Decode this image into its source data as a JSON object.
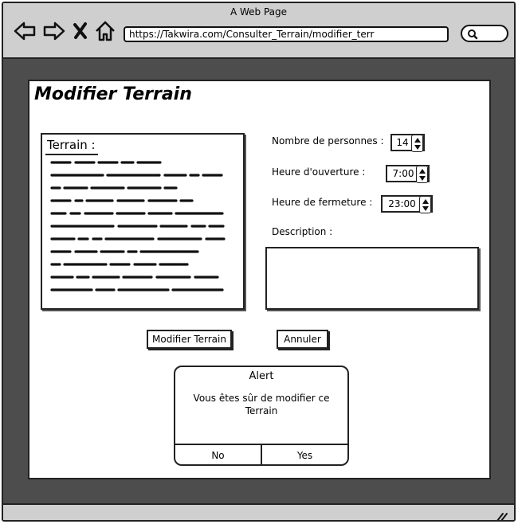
{
  "window": {
    "title": "A Web Page"
  },
  "browser": {
    "url": "https://Takwira.com/Consulter_Terrain/modifier_terr",
    "nav_icons": [
      "back-arrow-icon",
      "forward-arrow-icon",
      "close-x-icon",
      "home-icon"
    ]
  },
  "page": {
    "title": "Modifier Terrain",
    "terrain_label": "Terrain :",
    "fields": {
      "nombre_personnes": {
        "label": "Nombre de personnes :",
        "value": "14"
      },
      "heure_ouverture": {
        "label": "Heure d'ouverture :",
        "value": "7:00"
      },
      "heure_fermeture": {
        "label": "Heure de fermeture :",
        "value": "23:00"
      },
      "description": {
        "label": "Description :",
        "value": ""
      }
    },
    "buttons": {
      "modifier": "Modifier Terrain",
      "annuler": "Annuler"
    }
  },
  "alert": {
    "title": "Alert",
    "message": "Vous êtes sûr de modifier ce Terrain",
    "no_label": "No",
    "yes_label": "Yes"
  }
}
